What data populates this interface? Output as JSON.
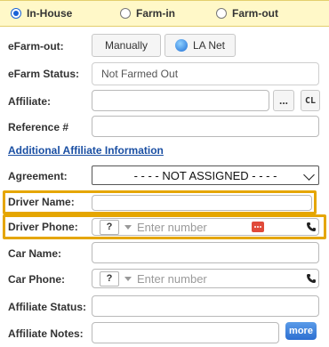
{
  "radios": [
    {
      "label": "In-House",
      "selected": true
    },
    {
      "label": "Farm-in",
      "selected": false
    },
    {
      "label": "Farm-out",
      "selected": false
    }
  ],
  "labels": {
    "efarm_out": "eFarm-out:",
    "efarm_status": "eFarm Status:",
    "affiliate": "Affiliate:",
    "reference": "Reference #",
    "agreement": "Agreement:",
    "driver_name": "Driver Name:",
    "driver_phone": "Driver Phone:",
    "car_name": "Car Name:",
    "car_phone": "Car Phone:",
    "affiliate_status": "Affiliate Status:",
    "affiliate_notes": "Affiliate Notes:"
  },
  "efarm_out": {
    "manual_label": "Manually",
    "lanet_label": "LA Net"
  },
  "efarm_status": {
    "value": "Not Farmed Out"
  },
  "affiliate": {
    "ellipsis_label": "...",
    "clear_label": "CL"
  },
  "additional_link": "Additional Affiliate Information",
  "agreement": {
    "selected": "- - - - NOT ASSIGNED - - - -"
  },
  "phone": {
    "country_code": "?",
    "placeholder": "Enter number"
  },
  "notes": {
    "more_label": "more"
  },
  "colors": {
    "highlight": "#e5a600",
    "radio_bar": "#fff8c8",
    "link": "#1a4fa3",
    "more_button": "#2d6fd1",
    "chat_icon": "#e04a3a"
  },
  "icons": {
    "lanet": "globe-icon",
    "call": "phone-icon",
    "chat": "chat-icon",
    "dropdown": "chevron-down-icon",
    "caret": "caret-down-icon"
  }
}
